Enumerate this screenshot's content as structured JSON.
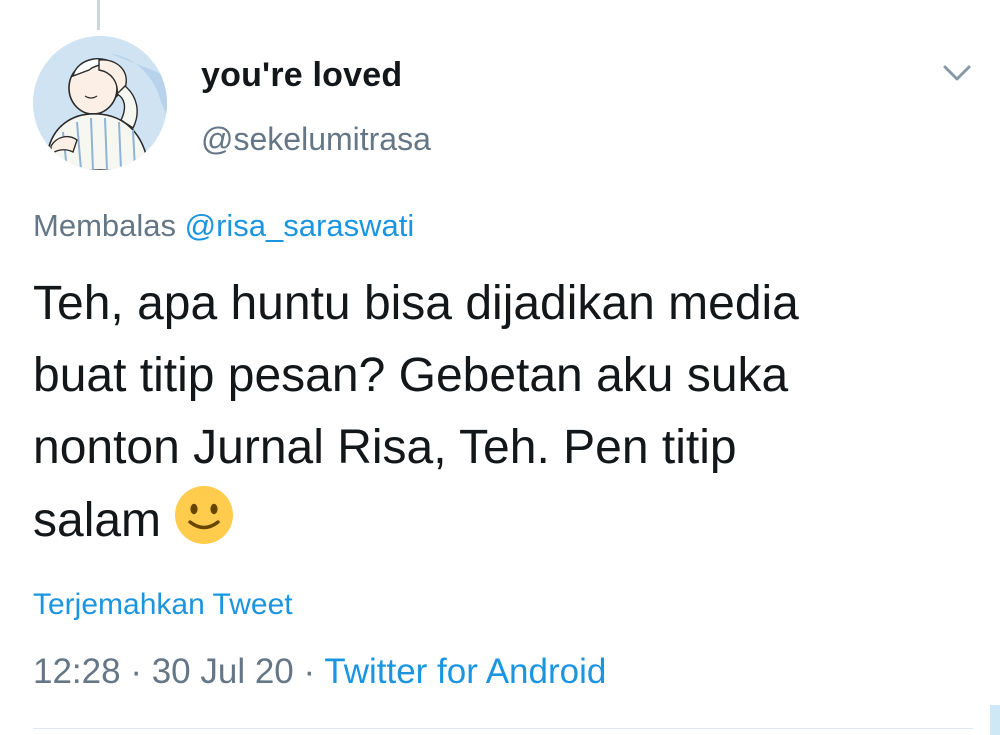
{
  "tweet": {
    "author": {
      "display_name": "you're loved",
      "handle": "@sekelumitrasa",
      "avatar_icon": "avatar-illustration-icon"
    },
    "reply_context": {
      "prefix": "Membalas",
      "mention": "@risa_saraswati"
    },
    "text_lines": [
      "Teh, apa huntu bisa dijadikan media",
      "buat titip pesan? Gebetan aku suka",
      "nonton Jurnal Risa, Teh. Pen titip",
      "salam"
    ],
    "emoji": "slightly-smiling-face-icon",
    "translate_label": "Terjemahkan Tweet",
    "time": "12:28",
    "date": "30 Jul 20",
    "separator": "·",
    "source": "Twitter for Android",
    "menu_icon": "chevron-down-icon"
  },
  "colors": {
    "text": "#14171a",
    "secondary": "#657786",
    "link": "#1b95e0",
    "divider": "#e1e8ed",
    "emoji_face": "#ffcc4d"
  }
}
